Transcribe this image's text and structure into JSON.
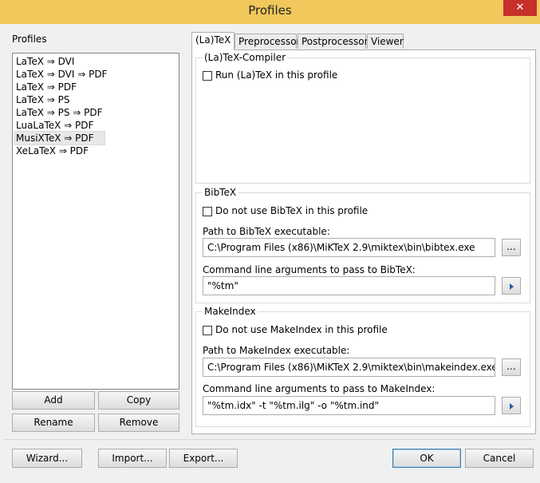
{
  "window": {
    "title": "Profiles",
    "close_label": "✕"
  },
  "profiles": {
    "label": "Profiles",
    "items": [
      "LaTeX ⇒ DVI",
      "LaTeX ⇒ DVI ⇒ PDF",
      "LaTeX ⇒ PDF",
      "LaTeX ⇒ PS",
      "LaTeX ⇒ PS ⇒ PDF",
      "LuaLaTeX ⇒ PDF",
      "MusiXTeX ⇒ PDF",
      "XeLaTeX ⇒ PDF"
    ],
    "selected_index": 6,
    "buttons": {
      "add": "Add",
      "copy": "Copy",
      "rename": "Rename",
      "remove": "Remove"
    }
  },
  "tabs": [
    "(La)TeX",
    "Preprocessor",
    "Postprocessor",
    "Viewer"
  ],
  "compiler": {
    "group_title": "(La)TeX-Compiler",
    "run_label": "Run (La)TeX in this profile",
    "run_checked": false
  },
  "bibtex": {
    "group_title": "BibTeX",
    "disable_label": "Do not use BibTeX in this profile",
    "disable_checked": false,
    "path_label": "Path to BibTeX executable:",
    "path_value": "C:\\Program Files (x86)\\MiKTeX 2.9\\miktex\\bin\\bibtex.exe",
    "browse_label": "...",
    "args_label": "Command line arguments to pass to BibTeX:",
    "args_value": "\"%tm\""
  },
  "makeindex": {
    "group_title": "MakeIndex",
    "disable_label": "Do not use MakeIndex in this profile",
    "disable_checked": false,
    "path_label": "Path to MakeIndex executable:",
    "path_value": "C:\\Program Files (x86)\\MiKTeX 2.9\\miktex\\bin\\makeindex.exe",
    "browse_label": "...",
    "args_label": "Command line arguments to pass to MakeIndex:",
    "args_value": "\"%tm.idx\" -t \"%tm.ilg\" -o \"%tm.ind\""
  },
  "footer": {
    "wizard": "Wizard...",
    "import": "Import...",
    "export": "Export...",
    "ok": "OK",
    "cancel": "Cancel"
  }
}
